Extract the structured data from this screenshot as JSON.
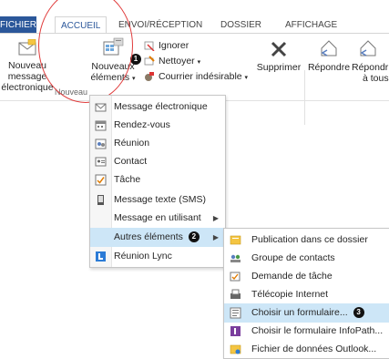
{
  "tabs": {
    "fichier": "FICHIER",
    "accueil": "ACCUEIL",
    "envoi": "ENVOI/RÉCEPTION",
    "dossier": "DOSSIER",
    "affichage": "AFFICHAGE"
  },
  "ribbon": {
    "nouveau_message_line1": "Nouveau message",
    "nouveau_message_line2": "électronique",
    "nouveaux_elements_line1": "Nouveaux",
    "nouveaux_elements_line2": "éléments",
    "ignorer": "Ignorer",
    "nettoyer": "Nettoyer",
    "courrier_indesirable": "Courrier indésirable",
    "supprimer": "Supprimer",
    "repondre": "Répondre",
    "repondre_tous_line1": "Répondr",
    "repondre_tous_line2": "à tous",
    "group_nouveau": "Nouveau"
  },
  "badges": {
    "one": "1",
    "two": "2",
    "three": "3"
  },
  "menu_nouveaux": {
    "items": [
      {
        "label": "Message électronique"
      },
      {
        "label": "Rendez-vous"
      },
      {
        "label": "Réunion"
      },
      {
        "label": "Contact"
      },
      {
        "label": "Tâche"
      },
      {
        "label": "Message texte (SMS)"
      },
      {
        "label": "Message en utilisant"
      },
      {
        "label": "Autres éléments"
      },
      {
        "label": "Réunion Lync"
      }
    ]
  },
  "menu_autres": {
    "items": [
      {
        "label": "Publication dans ce dossier"
      },
      {
        "label": "Groupe de contacts"
      },
      {
        "label": "Demande de tâche"
      },
      {
        "label": "Télécopie Internet"
      },
      {
        "label": "Choisir un formulaire..."
      },
      {
        "label": "Choisir le formulaire InfoPath..."
      },
      {
        "label": "Fichier de données Outlook..."
      }
    ]
  },
  "colors": {
    "accent": "#2b579a",
    "highlight": "#cde6f7",
    "annotation_circle": "#e03b3b"
  }
}
